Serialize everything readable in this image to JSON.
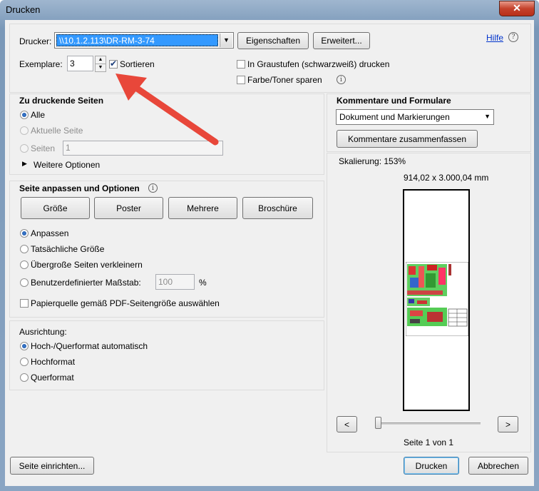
{
  "window": {
    "title": "Drucken",
    "close": "✕"
  },
  "printer": {
    "label": "Drucker:",
    "selected": "\\\\10.1.2.113\\DR-RM-3-74",
    "properties_button": "Eigenschaften",
    "advanced_button": "Erweitert...",
    "help_link": "Hilfe",
    "help_icon": "?"
  },
  "copies": {
    "label": "Exemplare:",
    "value": "3",
    "collate_label": "Sortieren",
    "collate_checked": true
  },
  "options": {
    "grayscale_label": "In Graustufen (schwarzweiß) drucken",
    "save_toner_label": "Farbe/Toner sparen"
  },
  "pages": {
    "title": "Zu druckende Seiten",
    "all": "Alle",
    "current": "Aktuelle Seite",
    "pages": "Seiten",
    "pages_value": "1",
    "more": "Weitere Optionen"
  },
  "sizing": {
    "title": "Seite anpassen und Optionen",
    "tabs": [
      "Größe",
      "Poster",
      "Mehrere",
      "Broschüre"
    ],
    "fit": "Anpassen",
    "actual": "Tatsächliche Größe",
    "shrink": "Übergroße Seiten verkleinern",
    "custom": "Benutzerdefinierter Maßstab:",
    "custom_value": "100",
    "percent": "%",
    "paper_source": "Papierquelle gemäß PDF-Seitengröße auswählen"
  },
  "orientation": {
    "title": "Ausrichtung:",
    "auto": "Hoch-/Querformat automatisch",
    "portrait": "Hochformat",
    "landscape": "Querformat"
  },
  "comments": {
    "title": "Kommentare und Formulare",
    "selected": "Dokument und Markierungen",
    "summarize_button": "Kommentare zusammenfassen"
  },
  "preview": {
    "scale": "Skalierung: 153%",
    "dimensions": "914,02 x 3.000,04 mm",
    "prev": "<",
    "next": ">",
    "page_info": "Seite 1 von 1"
  },
  "footer": {
    "page_setup": "Seite einrichten...",
    "print": "Drucken",
    "cancel": "Abbrechen"
  },
  "colors": {
    "accent": "#3399ff",
    "arrow": "#e8473a",
    "link": "#0033cc"
  }
}
